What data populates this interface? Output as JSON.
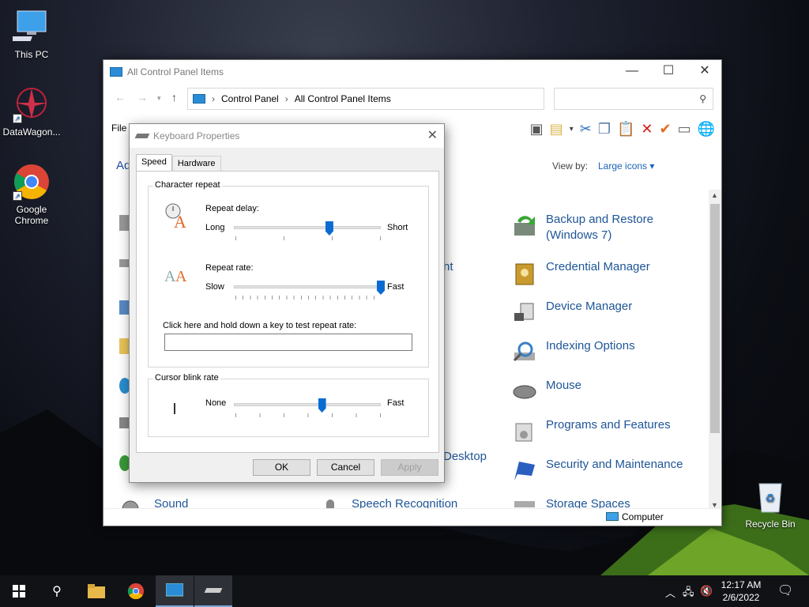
{
  "desktop": {
    "icons": [
      {
        "label": "This PC"
      },
      {
        "label": "DataWagon..."
      },
      {
        "label": "Google\nChrome"
      },
      {
        "label": "Recycle Bin"
      }
    ]
  },
  "explorer": {
    "title": "All Control Panel Items",
    "breadcrumb": [
      "Control Panel",
      "All Control Panel Items"
    ],
    "file_menu": "File",
    "adjust_text": "Ad",
    "view_by_label": "View by:",
    "view_by_value": "Large icons",
    "status_computer": "Computer",
    "items": [
      {
        "label": "Backup and Restore (Windows 7)",
        "icon": "backup-icon"
      },
      {
        "label": "Credential Manager",
        "icon": "credential-icon"
      },
      {
        "label": "Device Manager",
        "icon": "device-manager-icon"
      },
      {
        "label": "Indexing Options",
        "icon": "indexing-icon"
      },
      {
        "label": "Mouse",
        "icon": "mouse-icon"
      },
      {
        "label": "Programs and Features",
        "icon": "programs-icon"
      },
      {
        "label": "Security and Maintenance",
        "icon": "flag-icon"
      },
      {
        "label": "Storage Spaces",
        "icon": "storage-icon"
      },
      {
        "label": "nt",
        "icon": ""
      },
      {
        "label": "Desktop",
        "icon": ""
      },
      {
        "label": "Sound",
        "icon": "sound-icon"
      },
      {
        "label": "Speech Recognition",
        "icon": "microphone-icon"
      }
    ]
  },
  "dialog": {
    "title": "Keyboard Properties",
    "tabs": [
      "Speed",
      "Hardware"
    ],
    "character_repeat": {
      "group_label": "Character repeat",
      "repeat_delay_label": "Repeat delay:",
      "delay_left": "Long",
      "delay_right": "Short",
      "delay_value": 0.65,
      "repeat_rate_label": "Repeat rate:",
      "rate_left": "Slow",
      "rate_right": "Fast",
      "rate_value": 1.0,
      "test_label": "Click here and hold down a key to test repeat rate:"
    },
    "cursor_blink": {
      "group_label": "Cursor blink rate",
      "left": "None",
      "right": "Fast",
      "value": 0.6
    },
    "buttons": {
      "ok": "OK",
      "cancel": "Cancel",
      "apply": "Apply"
    }
  },
  "taskbar": {
    "time": "12:17 AM",
    "date": "2/6/2022"
  }
}
